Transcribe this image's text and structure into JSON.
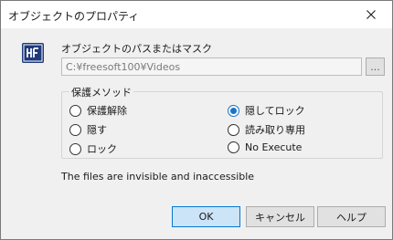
{
  "window": {
    "title": "オブジェクトのプロパティ"
  },
  "icons": {
    "close": "close-icon",
    "logo": "hf-logo-icon"
  },
  "path": {
    "label": "オブジェクトのパスまたはマスク",
    "value": "C:¥freesoft100¥Videos",
    "browse_label": "..."
  },
  "protection": {
    "group_label": "保護メソッド",
    "options": [
      {
        "label": "保護解除",
        "checked": false
      },
      {
        "label": "隠す",
        "checked": false
      },
      {
        "label": "ロック",
        "checked": false
      },
      {
        "label": "隠してロック",
        "checked": true
      },
      {
        "label": "読み取り専用",
        "checked": false
      },
      {
        "label": "No Execute",
        "checked": false
      }
    ]
  },
  "status_text": "The files are invisible and inaccessible",
  "buttons": {
    "ok": "OK",
    "cancel": "キャンセル",
    "help": "ヘルプ"
  },
  "colors": {
    "accent": "#0078d7",
    "radio_checked": "#1a73c8",
    "logo_bg": "#1f3a7a"
  }
}
